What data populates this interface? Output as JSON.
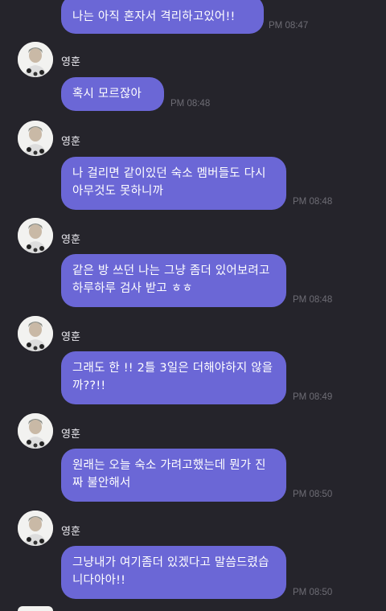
{
  "messages": [
    {
      "text": "나는 아직 혼자서 격리하고있어!!",
      "time": "PM 08:47"
    },
    {
      "sender": "영훈",
      "text": "혹시 모르잖아",
      "time": "PM 08:48"
    },
    {
      "sender": "영훈",
      "text": "나 걸리면 같이있던 숙소 멤버들도 다시 아무것도 못하니까",
      "time": "PM 08:48"
    },
    {
      "sender": "영훈",
      "text": "같은 방 쓰던 나는 그냥 좀더 있어보려고 하루하루 검사 받고 ㅎㅎ",
      "time": "PM 08:48"
    },
    {
      "sender": "영훈",
      "text": "그래도 한 !! 2틀 3일은 더해야하지 않을까??!!",
      "time": "PM 08:49"
    },
    {
      "sender": "영훈",
      "text": "원래는 오늘 숙소 가려고했는데 뭔가 진짜 불안해서",
      "time": "PM 08:50"
    },
    {
      "sender": "영훈",
      "text": "그냥내가 여기좀더 있겠다고 말씀드렸습니다아아!!",
      "time": "PM 08:50"
    }
  ],
  "colors": {
    "background": "#25242b",
    "bubble": "#6b67d6",
    "time": "#6e6d75"
  }
}
